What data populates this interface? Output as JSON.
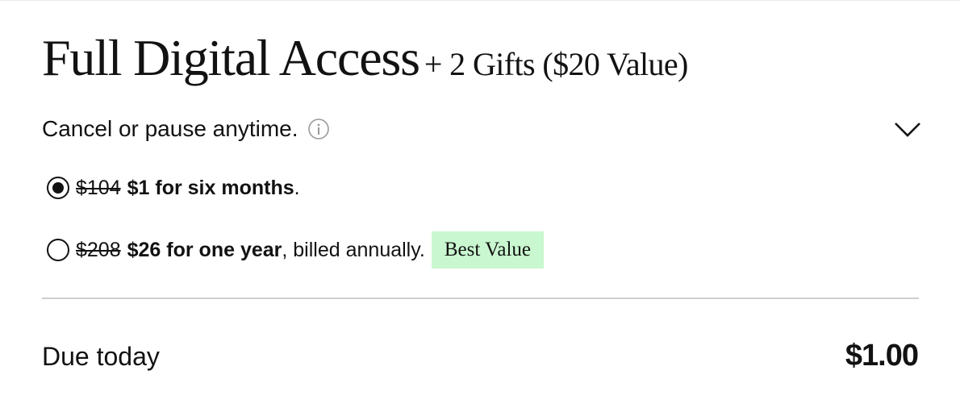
{
  "product": {
    "title": "Full Digital Access",
    "subtitle": "+ 2 Gifts ($20 Value)"
  },
  "cancel_row": {
    "text": "Cancel or pause anytime.",
    "info_icon": "info-icon",
    "toggle_icon": "chevron-down-icon"
  },
  "options": [
    {
      "selected": true,
      "original_price": "$104",
      "offer": "$1 for six months",
      "suffix": "."
    },
    {
      "selected": false,
      "original_price": "$208",
      "offer": "$26 for one year",
      "suffix": ", billed annually.",
      "badge": "Best Value"
    }
  ],
  "summary": {
    "due_label": "Due today",
    "due_amount": "$1.00"
  },
  "colors": {
    "text": "#121212",
    "badge_bg": "#c9f7d0",
    "divider": "#cfcfcf",
    "info_icon": "#9a9a9a"
  }
}
